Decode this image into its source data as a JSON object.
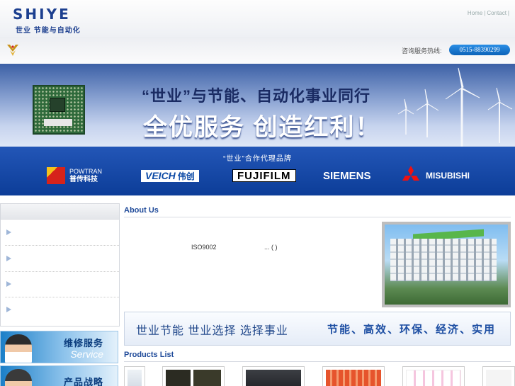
{
  "header": {
    "logo_text": "SHIYE",
    "logo_sub": "世业 节能与自动化",
    "links": [
      "Home",
      "Contact"
    ]
  },
  "subbar": {
    "hotline_label": "咨询服务热线:",
    "hotline_phone": "0515-88390299"
  },
  "banner": {
    "title": "“世业”与节能、自动化事业同行",
    "slogan": "全优服务 创造红利！"
  },
  "brands": {
    "title": "“世业”合作代理品牌",
    "items": [
      {
        "name": "POWTRAN",
        "sub": "普传科技"
      },
      {
        "name": "VEICH",
        "sub": "伟创"
      },
      {
        "name": "FUJIFILM",
        "sub": ""
      },
      {
        "name": "SIEMENS",
        "sub": ""
      },
      {
        "name": "MISUBISHI",
        "sub": ""
      }
    ]
  },
  "sidebar": {
    "items": [
      {
        "label": ""
      },
      {
        "label": ""
      },
      {
        "label": ""
      },
      {
        "label": ""
      }
    ]
  },
  "services": [
    {
      "main": "维修服务",
      "sub": "Service"
    },
    {
      "main": "产品战略",
      "sub": ""
    }
  ],
  "about": {
    "title": "About Us",
    "text": "ISO9002",
    "more": "... (        )"
  },
  "slogan_strip": {
    "left": "世业节能  世业选择  选择事业",
    "right": "节能、高效、环保、经济、实用"
  },
  "products": {
    "title": "Products List"
  },
  "colors": {
    "brand_blue": "#1c3f8f",
    "heading_blue": "#1f4a99",
    "hotline": "#0c63b8"
  }
}
